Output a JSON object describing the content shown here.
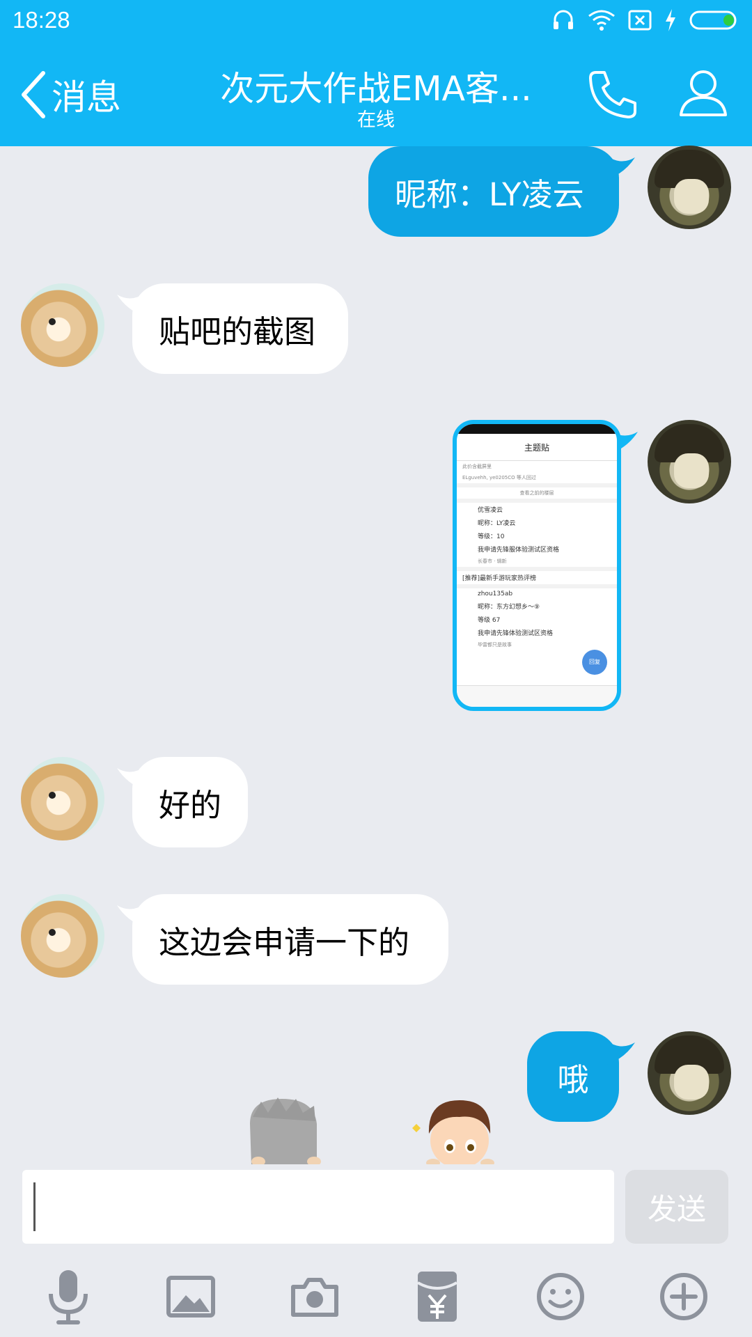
{
  "status_bar": {
    "time": "18:28"
  },
  "header": {
    "back_label": "消息",
    "title": "次元大作战EMA客...",
    "subtitle": "在线"
  },
  "messages": [
    {
      "sender": "me",
      "text": "昵称：LY凌云"
    },
    {
      "sender": "other",
      "text": "贴吧的截图"
    },
    {
      "sender": "me",
      "type": "image"
    },
    {
      "sender": "other",
      "text": "好的"
    },
    {
      "sender": "other",
      "text": "这边会申请一下的"
    },
    {
      "sender": "me",
      "text": "哦"
    }
  ],
  "screenshot": {
    "header_title": "主题贴",
    "line1": "此价含截屏里",
    "line2": "ELguvehh, ye0205CO 等人回过",
    "line3": "查看之前的楼层",
    "post1_user": "优雪凌云",
    "post1_lines": [
      "昵称：LY凌云",
      "等级：10",
      "我申请先锋服体验测试区资格"
    ],
    "post1_loc": "长春市 · 辑新",
    "promo": "[推荐]最新手游玩家热评榜",
    "post2_user": "zhou135ab",
    "post2_lines": [
      "昵称：东方幻想乡～⑨",
      "等级 67",
      "我申请先锋体验测试区资格"
    ],
    "post3_user": "毕雷都只是故事",
    "fab_label": "回复"
  },
  "input": {
    "placeholder": "",
    "value": ""
  },
  "send_label": "发送",
  "colors": {
    "header": "#12b7f5",
    "my_bubble": "#0ea5e4",
    "other_bubble": "#ffffff",
    "background": "#e9ebf0"
  },
  "toolbar_icons": [
    "microphone-icon",
    "image-icon",
    "camera-icon",
    "red-packet-icon",
    "emoji-icon",
    "plus-icon"
  ]
}
